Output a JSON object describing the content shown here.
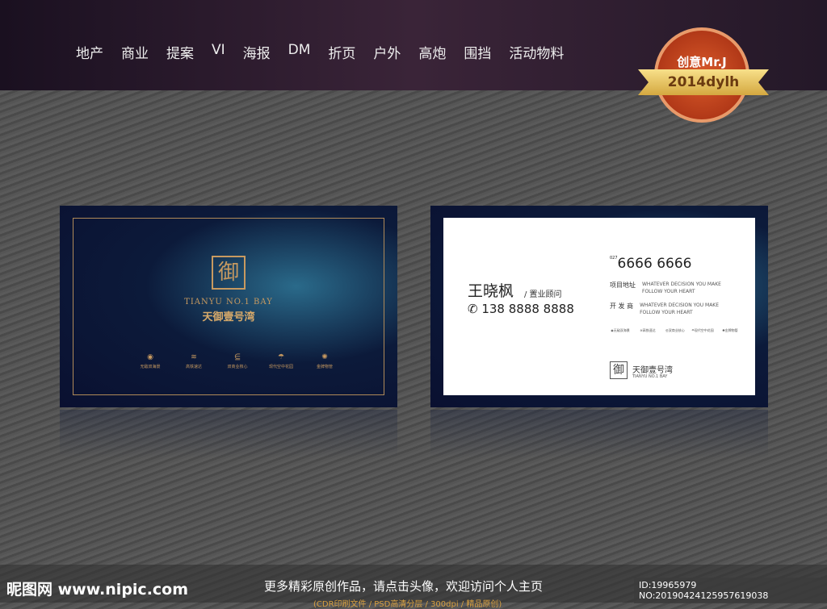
{
  "nav": [
    "地产",
    "商业",
    "提案",
    "VI",
    "海报",
    "DM",
    "折页",
    "户外",
    "高炮",
    "围挡",
    "活动物料"
  ],
  "badge": {
    "top": "创意Mr.J",
    "ribbon": "2014dylh"
  },
  "front": {
    "logo": "御",
    "en": "TIANYU NO.1 BAY",
    "cn": "天御壹号湾",
    "features": [
      {
        "icon": "◉",
        "label": "无敌双海景"
      },
      {
        "icon": "≋",
        "label": "高铁速达"
      },
      {
        "icon": "⋸",
        "label": "双商业核心"
      },
      {
        "icon": "☂",
        "label": "现代空中花园"
      },
      {
        "icon": "✺",
        "label": "金牌物管"
      }
    ]
  },
  "back": {
    "name": "王晓枫",
    "role": "/ 置业顾问",
    "mobile": "138 8888 8888",
    "area": "027",
    "tel": "6666 6666",
    "rows": [
      {
        "label": "项目地址",
        "text": "WHATEVER DECISION YOU MAKE FOLLOW YOUR HEART"
      },
      {
        "label": "开 发 商",
        "text": "WHATEVER DECISION YOU MAKE FOLLOW YOUR HEART"
      }
    ],
    "logo": "御",
    "cn": "天御壹号湾",
    "en": "TIANYU NO.1 BAY"
  },
  "footer": {
    "watermark": "昵图网 www.nipic.com",
    "message": "更多精彩原创作品，请点击头像，欢迎访问个人主页",
    "id": "ID:19965979 NO:20190424125957619038",
    "sub": "(CDR印刷文件 / PSD高清分层 / 300dpi / 精品原创)"
  }
}
